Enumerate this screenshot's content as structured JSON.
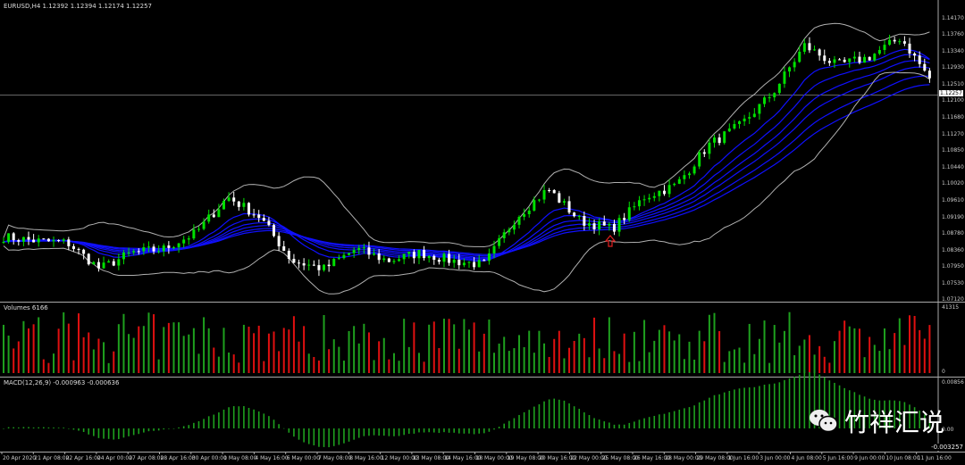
{
  "chart": {
    "symbol_title": "EURUSD,H4  1.12392 1.12394 1.12174 1.12257",
    "current_price": "1.12257",
    "price_axis": [
      "1.14170",
      "1.13760",
      "1.13340",
      "1.12930",
      "1.12510",
      "1.12100",
      "1.11680",
      "1.11270",
      "1.10850",
      "1.10440",
      "1.10020",
      "1.09610",
      "1.09190",
      "1.08780",
      "1.08360",
      "1.07950",
      "1.07530",
      "1.07120"
    ],
    "time_axis": [
      "20 Apr 2020",
      "21 Apr 08:00",
      "22 Apr 16:00",
      "24 Apr 00:00",
      "27 Apr 08:00",
      "28 Apr 16:00",
      "30 Apr 00:00",
      "1 May 08:00",
      "4 May 16:00",
      "6 May 00:00",
      "7 May 08:00",
      "8 May 16:00",
      "12 May 00:00",
      "13 May 08:00",
      "14 May 16:00",
      "18 May 00:00",
      "19 May 08:00",
      "20 May 16:00",
      "22 May 00:00",
      "25 May 08:00",
      "26 May 16:00",
      "28 May 00:00",
      "29 May 08:00",
      "1 Jun 16:00",
      "3 Jun 00:00",
      "4 Jun 08:00",
      "5 Jun 16:00",
      "9 Jun 00:00",
      "10 Jun 08:00",
      "11 Jun 16:00"
    ],
    "approx_close_at_time_labels": [
      1.087,
      1.086,
      1.0855,
      1.079,
      1.083,
      1.084,
      1.088,
      1.097,
      1.092,
      1.081,
      1.079,
      1.084,
      1.081,
      1.083,
      1.081,
      1.08,
      1.092,
      1.099,
      1.091,
      1.089,
      1.097,
      1.1,
      1.11,
      1.115,
      1.123,
      1.135,
      1.13,
      1.132,
      1.137,
      1.1257
    ],
    "colors": {
      "bull": "#00e000",
      "bear": "#ffffff",
      "ma": "#1010ff",
      "bands": "#b0b0b0",
      "vol_up": "#1ea01e",
      "vol_down": "#e01010",
      "macd": "#1ea01e",
      "arrow": "#e02020"
    }
  },
  "volume": {
    "title": "Volumes 6166",
    "max_label": "41315",
    "min_label": "0"
  },
  "macd": {
    "title": "MACD(12,26,9) -0.000963 -0.000636",
    "max_label": "0.00856",
    "zero_label": "0.00",
    "min_label": "-0.003257"
  },
  "watermark": {
    "text": "竹祥汇说",
    "icon": "wechat-icon"
  }
}
